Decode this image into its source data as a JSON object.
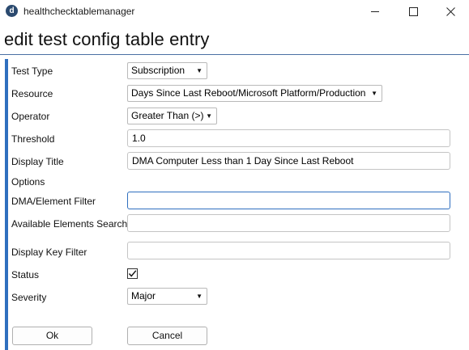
{
  "window": {
    "app_title": "healthchecktablemanager",
    "app_icon_letter": "d",
    "icons": {
      "minimize": "minimize-icon",
      "maximize": "maximize-icon",
      "close": "close-icon"
    }
  },
  "page": {
    "heading": "edit test config table entry"
  },
  "form": {
    "test_type": {
      "label": "Test Type",
      "value": "Subscription"
    },
    "resource": {
      "label": "Resource",
      "value": "Days Since Last Reboot/Microsoft Platform/Production"
    },
    "operator": {
      "label": "Operator",
      "value": "Greater Than (>)"
    },
    "threshold": {
      "label": "Threshold",
      "value": "1.0"
    },
    "display_title": {
      "label": "Display Title",
      "value": "DMA Computer Less than 1 Day Since Last Reboot"
    },
    "options": {
      "label": "Options"
    },
    "dma_element_filter": {
      "label": "DMA/Element Filter",
      "value": ""
    },
    "available_elements_search": {
      "label": "Available Elements Search",
      "value": ""
    },
    "display_key_filter": {
      "label": "Display Key Filter",
      "value": ""
    },
    "status": {
      "label": "Status",
      "checked": true
    },
    "severity": {
      "label": "Severity",
      "value": "Major"
    }
  },
  "buttons": {
    "ok": "Ok",
    "cancel": "Cancel"
  },
  "colors": {
    "accent": "#2f6fbf",
    "heading_rule": "#4a6fa3"
  }
}
